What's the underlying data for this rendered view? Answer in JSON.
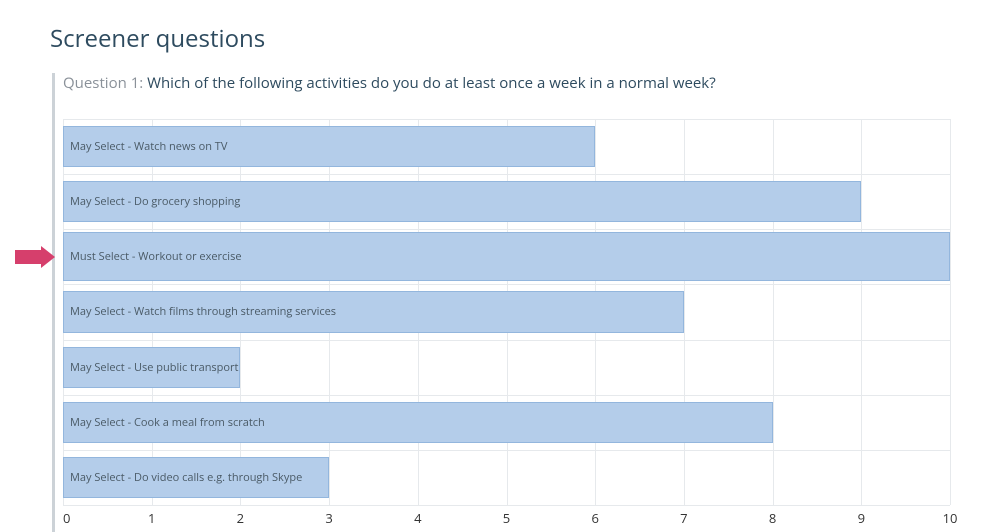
{
  "title": "Screener questions",
  "question": {
    "prefix": "Question 1:",
    "text": "Which of the following activities do you do at least once a week in a normal week?"
  },
  "chart_data": {
    "type": "bar",
    "orientation": "horizontal",
    "xlabel": "",
    "ylabel": "",
    "xlim": [
      0,
      10
    ],
    "ticks": [
      0,
      1,
      2,
      3,
      4,
      5,
      6,
      7,
      8,
      9,
      10
    ],
    "categories": [
      "May Select - Watch news on TV",
      "May Select - Do grocery shopping",
      "Must Select - Workout or exercise",
      "May Select - Watch films through streaming services",
      "May Select - Use public transport",
      "May Select - Cook a meal from scratch",
      "May Select - Do video calls e.g. through Skype"
    ],
    "values": [
      6,
      9,
      10,
      7,
      2,
      8,
      3
    ],
    "highlight_index": 2,
    "bar_color": "#b4cdea",
    "bar_border": "#93b6dd",
    "arrow_color": "#d63f6c"
  }
}
